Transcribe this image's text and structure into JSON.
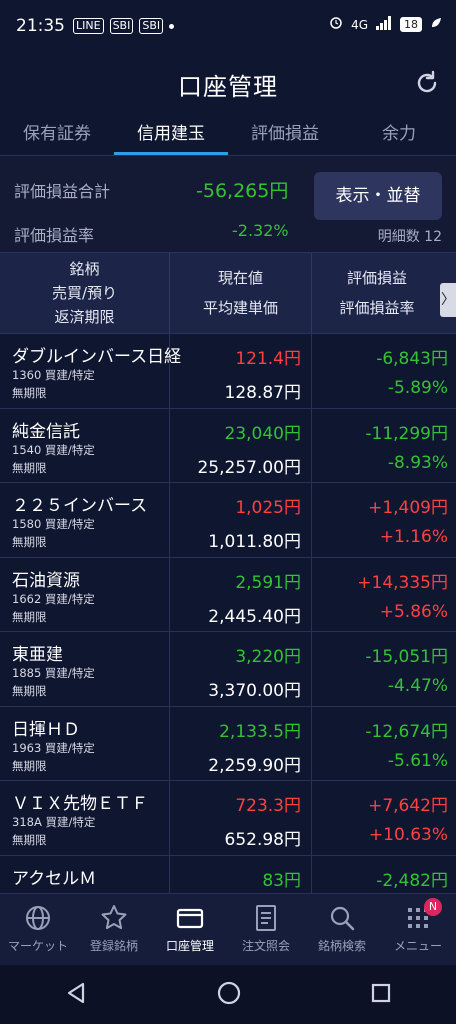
{
  "status_bar": {
    "time": "21:35",
    "icons": [
      "LINE",
      "SBI",
      "SBI"
    ],
    "signal": "4G",
    "battery": "18"
  },
  "header": {
    "title": "口座管理"
  },
  "tabs": [
    {
      "label": "保有証券",
      "active": false
    },
    {
      "label": "信用建玉",
      "active": true
    },
    {
      "label": "評価損益",
      "active": false
    },
    {
      "label": "余力",
      "active": false
    }
  ],
  "summary": {
    "total_label": "評価損益合計",
    "total_value": "-56,265円",
    "rate_label": "評価損益率",
    "rate_value": "-2.32%",
    "display_button": "表示・並替",
    "count_label": "明細数 12"
  },
  "table_header": {
    "col1": [
      "銘柄",
      "売買/預り",
      "返済期限"
    ],
    "col2": [
      "現在値",
      "平均建単価"
    ],
    "col3": [
      "評価損益",
      "評価損益率"
    ],
    "scroll_arrow": "〉"
  },
  "rows": [
    {
      "name": "ダブルインバース日経",
      "code": "1360 買建/特定",
      "term": "無期限",
      "price": "121.4円",
      "price_color": "red",
      "avg": "128.87円",
      "pl": "-6,843円",
      "pl_color": "green",
      "rate": "-5.89%",
      "rate_color": "green"
    },
    {
      "name": "純金信託",
      "code": "1540 買建/特定",
      "term": "無期限",
      "price": "23,040円",
      "price_color": "green",
      "avg": "25,257.00円",
      "pl": "-11,299円",
      "pl_color": "green",
      "rate": "-8.93%",
      "rate_color": "green"
    },
    {
      "name": "２２５インバース",
      "code": "1580 買建/特定",
      "term": "無期限",
      "price": "1,025円",
      "price_color": "red",
      "avg": "1,011.80円",
      "pl": "+1,409円",
      "pl_color": "red",
      "rate": "+1.16%",
      "rate_color": "red"
    },
    {
      "name": "石油資源",
      "code": "1662 買建/特定",
      "term": "無期限",
      "price": "2,591円",
      "price_color": "green",
      "avg": "2,445.40円",
      "pl": "+14,335円",
      "pl_color": "red",
      "rate": "+5.86%",
      "rate_color": "red"
    },
    {
      "name": "東亜建",
      "code": "1885 買建/特定",
      "term": "無期限",
      "price": "3,220円",
      "price_color": "green",
      "avg": "3,370.00円",
      "pl": "-15,051円",
      "pl_color": "green",
      "rate": "-4.47%",
      "rate_color": "green"
    },
    {
      "name": "日揮ＨＤ",
      "code": "1963 買建/特定",
      "term": "無期限",
      "price": "2,133.5円",
      "price_color": "green",
      "avg": "2,259.90円",
      "pl": "-12,674円",
      "pl_color": "green",
      "rate": "-5.61%",
      "rate_color": "green"
    },
    {
      "name": "ＶＩＸ先物ＥＴＦ",
      "code": "318A 買建/特定",
      "term": "無期限",
      "price": "723.3円",
      "price_color": "red",
      "avg": "652.98円",
      "pl": "+7,642円",
      "pl_color": "red",
      "rate": "+10.63%",
      "rate_color": "red"
    },
    {
      "name": "アクセルＭ",
      "code": "",
      "term": "",
      "price": "83円",
      "price_color": "green",
      "avg": "",
      "pl": "-2,482円",
      "pl_color": "green",
      "rate": "",
      "rate_color": "green"
    }
  ],
  "bottom_nav": [
    {
      "label": "マーケット",
      "icon": "globe-icon",
      "active": false
    },
    {
      "label": "登録銘柄",
      "icon": "star-icon",
      "active": false
    },
    {
      "label": "口座管理",
      "icon": "card-icon",
      "active": true
    },
    {
      "label": "注文照会",
      "icon": "document-icon",
      "active": false
    },
    {
      "label": "銘柄検索",
      "icon": "search-icon",
      "active": false
    },
    {
      "label": "メニュー",
      "icon": "grid-icon",
      "active": false,
      "badge": "N"
    }
  ],
  "colors": {
    "up": "#ff4040",
    "down": "#34c234",
    "accent": "#2aa0e6",
    "background": "#0f1630"
  }
}
